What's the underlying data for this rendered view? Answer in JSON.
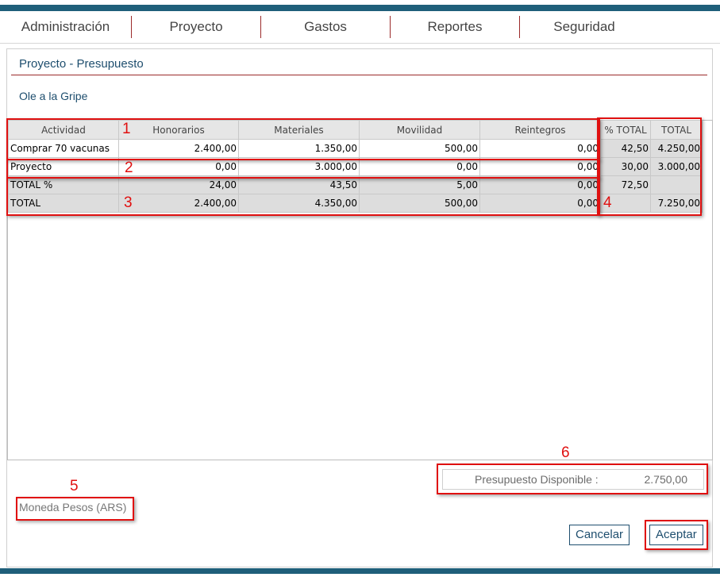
{
  "nav": {
    "items": [
      "Administración",
      "Proyecto",
      "Gastos",
      "Reportes",
      "Seguridad"
    ]
  },
  "page": {
    "title": "Proyecto - Presupuesto",
    "project_name": "Ole a la Gripe"
  },
  "table": {
    "headers": [
      "Actividad",
      "Honorarios",
      "Materiales",
      "Movilidad",
      "Reintegros",
      "% TOTAL",
      "TOTAL"
    ],
    "rows": [
      [
        "Comprar 70 vacunas",
        "2.400,00",
        "1.350,00",
        "500,00",
        "0,00",
        "42,50",
        "4.250,00"
      ],
      [
        "Proyecto",
        "0,00",
        "3.000,00",
        "0,00",
        "0,00",
        "30,00",
        "3.000,00"
      ]
    ],
    "total_percent_row": [
      "TOTAL %",
      "24,00",
      "43,50",
      "5,00",
      "0,00",
      "72,50",
      ""
    ],
    "total_row": [
      "TOTAL",
      "2.400,00",
      "4.350,00",
      "500,00",
      "0,00",
      "",
      "7.250,00"
    ]
  },
  "annotations": [
    "1",
    "2",
    "3",
    "4",
    "5",
    "6"
  ],
  "budget_available": {
    "label": "Presupuesto Disponible :",
    "value": "2.750,00"
  },
  "currency": "Moneda Pesos (ARS)",
  "buttons": {
    "cancel": "Cancelar",
    "accept": "Aceptar"
  },
  "colors": {
    "brand_bar": "#1f5f7a",
    "accent_red": "#9b2a2a",
    "highlight": "#e01010"
  }
}
